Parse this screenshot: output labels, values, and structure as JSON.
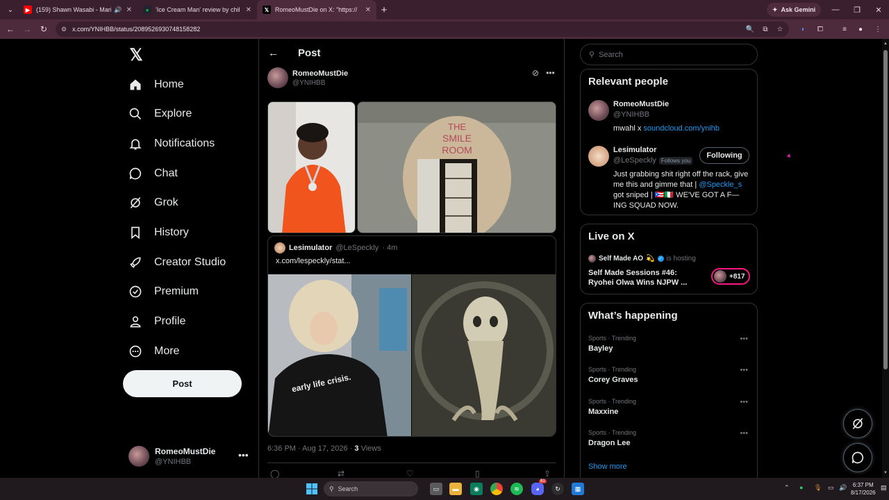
{
  "browser": {
    "tabs": [
      {
        "title": "(159) Shawn Wasabi - Mari",
        "favicon": "youtube-icon",
        "color": "#ff0000"
      },
      {
        "title": "'Ice Cream Man' review by chil",
        "favicon": "letterboxd-icon",
        "color": "#00c030"
      },
      {
        "title": "RomeoMustDie on X: \"https://",
        "favicon": "x-icon",
        "color": "#000000"
      }
    ],
    "ask_gemini": "Ask Gemini",
    "url": "x.com/YNIHBB/status/2089526930748158282"
  },
  "nav": {
    "items": [
      {
        "label": "Home",
        "icon": "home-icon"
      },
      {
        "label": "Explore",
        "icon": "search-icon"
      },
      {
        "label": "Notifications",
        "icon": "bell-icon"
      },
      {
        "label": "Chat",
        "icon": "chat-icon"
      },
      {
        "label": "Grok",
        "icon": "grok-icon"
      },
      {
        "label": "History",
        "icon": "bookmark-icon"
      },
      {
        "label": "Creator Studio",
        "icon": "rocket-icon"
      },
      {
        "label": "Premium",
        "icon": "verified-icon"
      },
      {
        "label": "Profile",
        "icon": "person-icon"
      },
      {
        "label": "More",
        "icon": "more-circle-icon"
      }
    ],
    "post_button": "Post",
    "account": {
      "name": "RomeoMustDie",
      "handle": "@YNIHBB"
    }
  },
  "post": {
    "header": "Post",
    "author": {
      "name": "RomeoMustDie",
      "handle": "@YNIHBB"
    },
    "images": [
      "portrait-orange-shirt",
      "the-smile-room-door"
    ],
    "quote": {
      "name": "Lesimulator",
      "handle": "@LeSpeckly",
      "time": "· 4m",
      "text": "x.com/lespeckly/stat...",
      "images": [
        "early-life-crisis-shirt",
        "skull-creature-drawing"
      ]
    },
    "time": "6:36 PM · Aug 17, 2026 ·",
    "views_count": "3",
    "views_label": "Views"
  },
  "sidebar": {
    "search_placeholder": "Search",
    "relevant_title": "Relevant people",
    "people": [
      {
        "name": "RomeoMustDie",
        "handle": "@YNIHBB",
        "bio_prefix": "mwahl x ",
        "bio_link": "soundcloud.com/ynihb"
      },
      {
        "name": "Lesimulator",
        "handle": "@LeSpeckly",
        "follows_you": "Follows you",
        "button": "Following",
        "bio_1": "Just grabbing shit right off the rack, give me this and gimme that |",
        "bio_link": "@Speckle_s",
        "bio_2": "got sniped | 🇵🇷🇮🇹 WE'VE GOT A F—ING SQUAD NOW."
      }
    ],
    "live_title": "Live on X",
    "live": {
      "host": "Self Made AO",
      "host_emoji": "💫",
      "status": "is hosting",
      "title": "Self Made Sessions #46: Ryohei Olwa Wins NJPW ...",
      "count": "+817"
    },
    "happening_title": "What’s happening",
    "trends": [
      {
        "category": "Sports · Trending",
        "name": "Bayley"
      },
      {
        "category": "Sports · Trending",
        "name": "Corey Graves"
      },
      {
        "category": "Sports · Trending",
        "name": "Maxxine"
      },
      {
        "category": "Sports · Trending",
        "name": "Dragon Lee"
      }
    ],
    "show_more": "Show more"
  },
  "taskbar": {
    "search": "Search",
    "time": "6:37 PM",
    "date": "8/17/2026",
    "discord_badge": "81"
  }
}
